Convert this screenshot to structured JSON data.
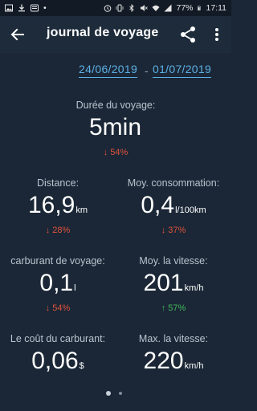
{
  "status_bar": {
    "battery": "77%",
    "time": "17:11"
  },
  "app_bar": {
    "title": "journal de voyage"
  },
  "date_range": {
    "start": "24/06/2019",
    "separator": "-",
    "end": "01/07/2019"
  },
  "stats": {
    "duration": {
      "label": "Durée du voyage:",
      "value": "5min",
      "unit": "",
      "change": "↓ 54%"
    },
    "distance": {
      "label": "Distance:",
      "value": "16,9",
      "unit": "km",
      "change": "↓ 28%"
    },
    "consumption": {
      "label": "Moy. consommation:",
      "value": "0,4",
      "unit": "l/100km",
      "change": "↓ 37%"
    },
    "fuel": {
      "label": "carburant de voyage:",
      "value": "0,1",
      "unit": "l",
      "change": "↓ 54%"
    },
    "avg_speed": {
      "label": "Moy. la vitesse:",
      "value": "201",
      "unit": "km/h",
      "change": "↑ 57%"
    },
    "fuel_cost": {
      "label": "Le coût du carburant:",
      "value": "0,06",
      "unit": "$",
      "change": ""
    },
    "max_speed": {
      "label": "Max. la vitesse:",
      "value": "220",
      "unit": "km/h",
      "change": ""
    }
  },
  "colors": {
    "background": "#1b2736",
    "accent": "#5cb0e6",
    "decrease": "#e0523c",
    "increase": "#43b85a"
  },
  "pager": {
    "pages": 2,
    "current": 1
  }
}
